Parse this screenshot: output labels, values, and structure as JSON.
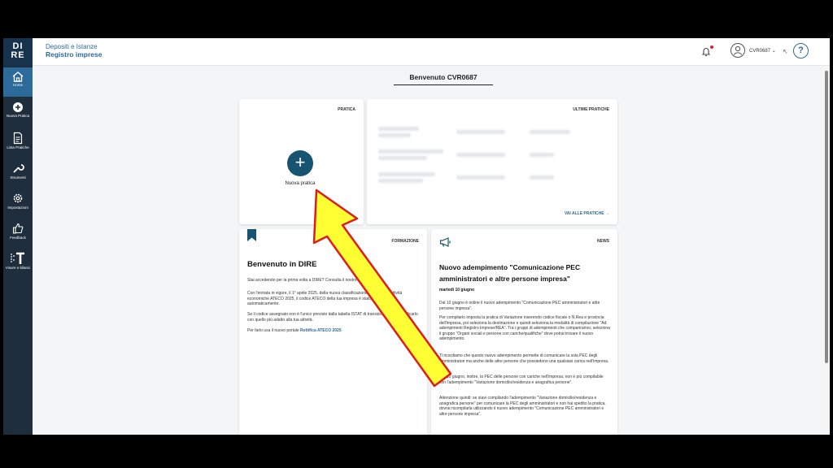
{
  "sidebar": {
    "logo_top": "DI",
    "logo_bottom": "RE",
    "items": [
      {
        "label": "Home",
        "icon": "home-icon"
      },
      {
        "label": "Nuova Pratica",
        "icon": "plus-circle-icon"
      },
      {
        "label": "Lista Pratiche",
        "icon": "document-list-icon"
      },
      {
        "label": "Strumenti",
        "icon": "wrench-icon"
      },
      {
        "label": "Impostazioni",
        "icon": "gear-icon"
      },
      {
        "label": "Feedback",
        "icon": "thumbs-up-icon"
      },
      {
        "label": "Visure e bilanci",
        "icon": "t-grid-icon"
      }
    ]
  },
  "header": {
    "subtitle": "Depositi e Istanze",
    "title": "Registro imprese",
    "user": "CVR0687",
    "help": "?"
  },
  "welcome": "Benvenuto CVR0687",
  "pratica": {
    "label": "PRATICA",
    "button_label": "Nuova pratica",
    "plus": "+"
  },
  "ultime": {
    "label": "ULTIME PRATICHE",
    "link": "VAI ALLE PRATICHE →"
  },
  "formazione": {
    "label": "FORMAZIONE",
    "title": "Benvenuto in DIRE",
    "p1_a": "Stai accedendo per la prima volta a DIRE? Consulta il nostro ",
    "p1_link": "tutorial",
    "p2": "Con l'entrata in vigore, il 1° aprile 2025, della nuova classificazione ISTAT delle attività economiche ATECO 2025, il codice ATECO della tua impresa è stato ridefinito automaticamente.",
    "p3": "Se il codice assegnato non è l'unico previsto dalla tabella ISTAT di transizione, puoi modificarlo con quello più adatto alla tua attività.",
    "p4_a": "Per farlo usa il nuovo portale ",
    "p4_link": "Rettifica ATECO 2025"
  },
  "news": {
    "label": "NEWS",
    "title_l1": "Nuovo adempimento \"Comunicazione PEC",
    "title_l2": "amministratori e altre persone impresa\"",
    "date": "martedì 10 giugno",
    "p1": "Dal 10 giugno è online il nuovo adempimento \"Comunicazione PEC amministratori e altre persone impresa\".",
    "p2": "Per compilarlo imposta la pratica di Variazione inserendo codice fiscale o N.Rea e provincia dell'impresa, poi seleziona la destinazione e quindi seleziona la modalità di compilazione \"Ad adempimenti Registro Imprese/REA\". Tra i gruppi di adempimenti che compariranno, seleziona il gruppo \"Organi sociali e persone con cariche/qualifiche\" dove potrai trovare il nuovo adempimento.",
    "p3": "Ti ricordiamo che questo nuovo adempimento permette di comunicare la sola PEC degli amministratori ma anche delle altre persone che possiedono una qualsiasi carica nell'impresa.",
    "p4": "Dal 10 giugno, inoltre, la PEC delle persone con cariche nell'impresa, non è più compilabile con l'adempimento \"Variazione domicilio/residenza e anagrafica persone\".",
    "p5": "Attenzione quindi: se stavi compilando l'adempimento \"Variazione domicilio/residenza e anagrafica persone\" per comunicare la PEC degli amministratori e non hai spedito la pratica, dovrai ricompilarla utilizzando il nuovo adempimento \"Comunicazione PEC amministratori e altre persone impresa\"."
  },
  "colors": {
    "sidebar": "#1f2e3d",
    "accent": "#2c6a99",
    "plus_button": "#17546f",
    "arrow_fill": "#ffff33",
    "arrow_stroke": "#e01b1b"
  }
}
